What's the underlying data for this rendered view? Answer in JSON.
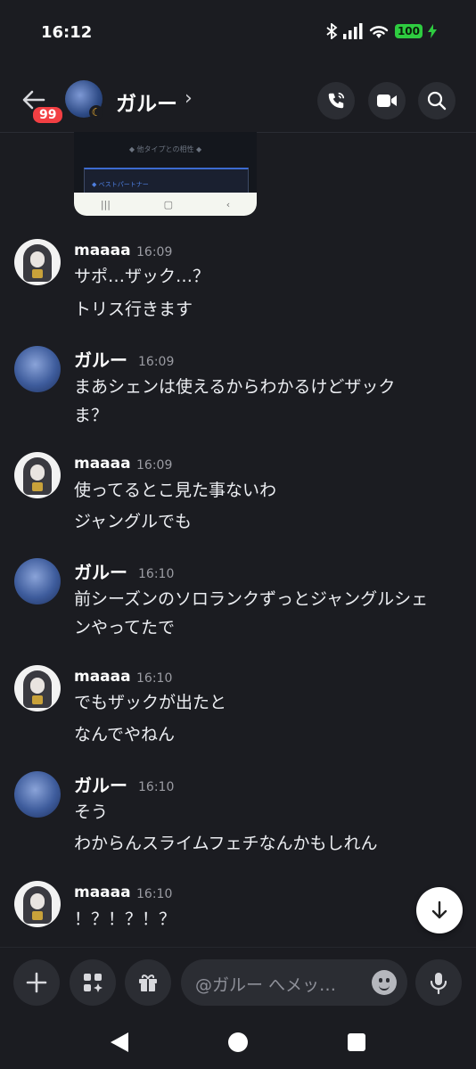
{
  "status": {
    "time": "16:12",
    "battery": "100"
  },
  "header": {
    "badge": "99",
    "title": "ガルー",
    "chevron": "›"
  },
  "preview": {
    "text": "◆ 他タイプとの相性 ◆",
    "box_label": "◆ ベストパートナー"
  },
  "messages": [
    {
      "author": "maaaa",
      "time": "16:09",
      "lines": [
        "サポ…ザック…？",
        "トリス行きます"
      ]
    },
    {
      "author": "ガルー",
      "time": "16:09",
      "lines": [
        "まあシェンは使えるからわかるけどザック",
        "ま？"
      ]
    },
    {
      "author": "maaaa",
      "time": "16:09",
      "lines": [
        "使ってるとこ見た事ないわ",
        "ジャングルでも"
      ]
    },
    {
      "author": "ガルー",
      "time": "16:10",
      "lines": [
        "前シーズンのソロランクずっとジャングルシェ",
        "ンやってたで"
      ]
    },
    {
      "author": "maaaa",
      "time": "16:10",
      "lines": [
        "でもザックが出たと",
        "なんでやねん"
      ]
    },
    {
      "author": "ガルー",
      "time": "16:10",
      "lines": [
        "そう",
        "わからんスライムフェチなんかもしれん"
      ]
    },
    {
      "author": "maaaa",
      "time": "16:10",
      "lines": [
        "！？！？！？"
      ]
    }
  ],
  "composer": {
    "placeholder": "@ガルー へメッ…"
  },
  "icons": {
    "back": "arrow-left-icon",
    "call": "phone-call-icon",
    "video": "video-camera-icon",
    "search": "search-icon",
    "add": "plus-icon",
    "apps": "apps-icon",
    "gift": "gift-icon",
    "emoji": "emoji-icon",
    "mic": "microphone-icon",
    "scroll": "arrow-down-icon"
  },
  "colors": {
    "background": "#1b1c21",
    "badge": "#f23f43",
    "battery": "#2ecc40"
  }
}
